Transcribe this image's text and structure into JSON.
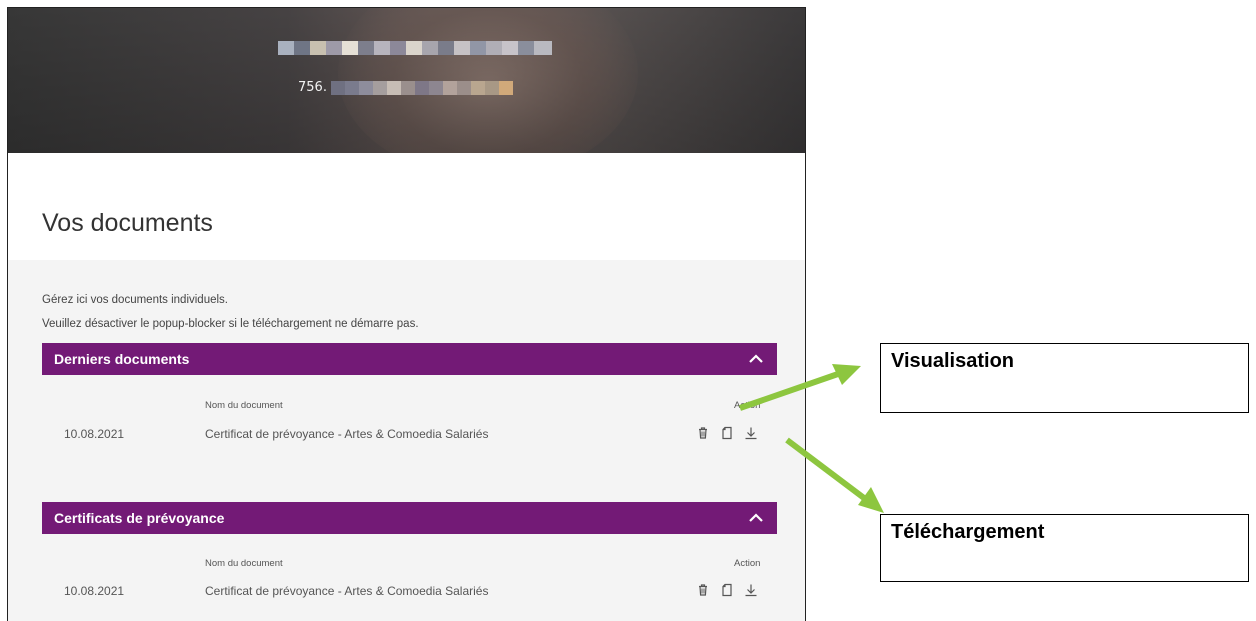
{
  "header": {
    "name_pixels": [
      "#a9b1bf",
      "#6f7585",
      "#c8c0b0",
      "#9e9aa8",
      "#e6e0d6",
      "#7d7e8c",
      "#b7b4bd",
      "#8c8899",
      "#dad4cb",
      "#a7a5ad",
      "#7a7c8a",
      "#c6c2c5",
      "#9196a6",
      "#b0aeb6",
      "#c7c3c9",
      "#8a8e9c",
      "#b9b9c0"
    ],
    "id_prefix": "756.",
    "id_pixels": [
      "#6f7081",
      "#7a7b8d",
      "#8e8d9c",
      "#a59e9e",
      "#c7bdb5",
      "#9a8f8d",
      "#7e7787",
      "#8d8690",
      "#b2a29b",
      "#9b8e8a",
      "#b9a68f",
      "#a89885",
      "#d1a97a"
    ]
  },
  "page": {
    "title": "Vos documents",
    "intro_1": "Gérez ici vos documents individuels.",
    "intro_2": "Veuillez désactiver le popup-blocker si le téléchargement ne démarre pas."
  },
  "sections": [
    {
      "title": "Derniers documents",
      "col_name": "Nom du document",
      "col_action": "Action",
      "row": {
        "date": "10.08.2021",
        "name": "Certificat de prévoyance - Artes & Comoedia Salariés"
      }
    },
    {
      "title": "Certificats de prévoyance",
      "col_name": "Nom du document",
      "col_action": "Action",
      "row": {
        "date": "10.08.2021",
        "name": "Certificat de prévoyance - Artes & Comoedia Salariés"
      }
    }
  ],
  "annotations": {
    "view_label": "Visualisation",
    "download_label": "Téléchargement",
    "arrow_color": "#8dc63f"
  },
  "colors": {
    "accent": "#731a76",
    "panel": "#f4f4f4"
  },
  "icons": [
    "trash-icon",
    "document-icon",
    "download-icon",
    "chevron-up-icon"
  ]
}
